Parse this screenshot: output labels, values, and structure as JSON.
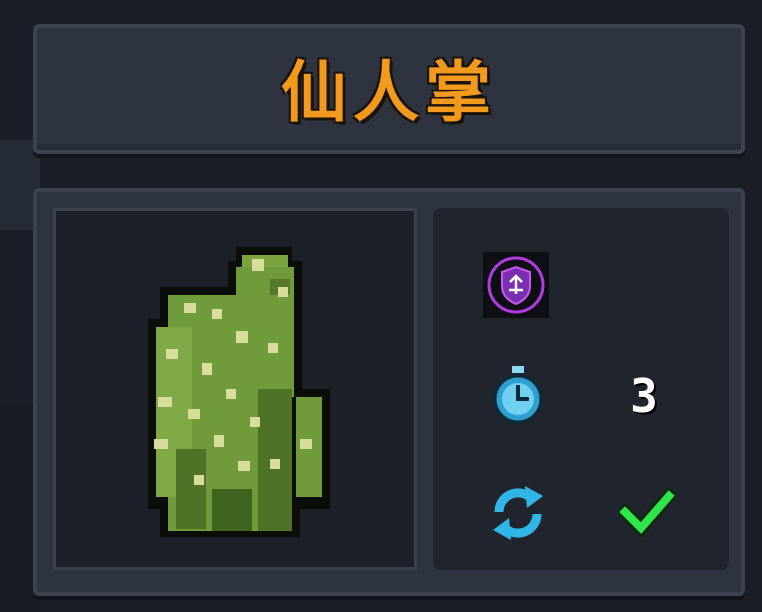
{
  "item": {
    "name": "仙人掌",
    "image_icon": "cactus-sprite",
    "badge_icon": "purple-shield-badge-icon",
    "timer_icon": "stopwatch-icon",
    "timer_value": "3",
    "refresh_icon": "refresh-icon",
    "status_icon": "checkmark-icon"
  },
  "colors": {
    "title": "#f29a1d",
    "panel": "#2d3440",
    "accent_cyan": "#2fb6e6",
    "accent_green": "#2ee64a",
    "accent_purple": "#b33ae0",
    "cactus_green": "#6f9b3a"
  }
}
